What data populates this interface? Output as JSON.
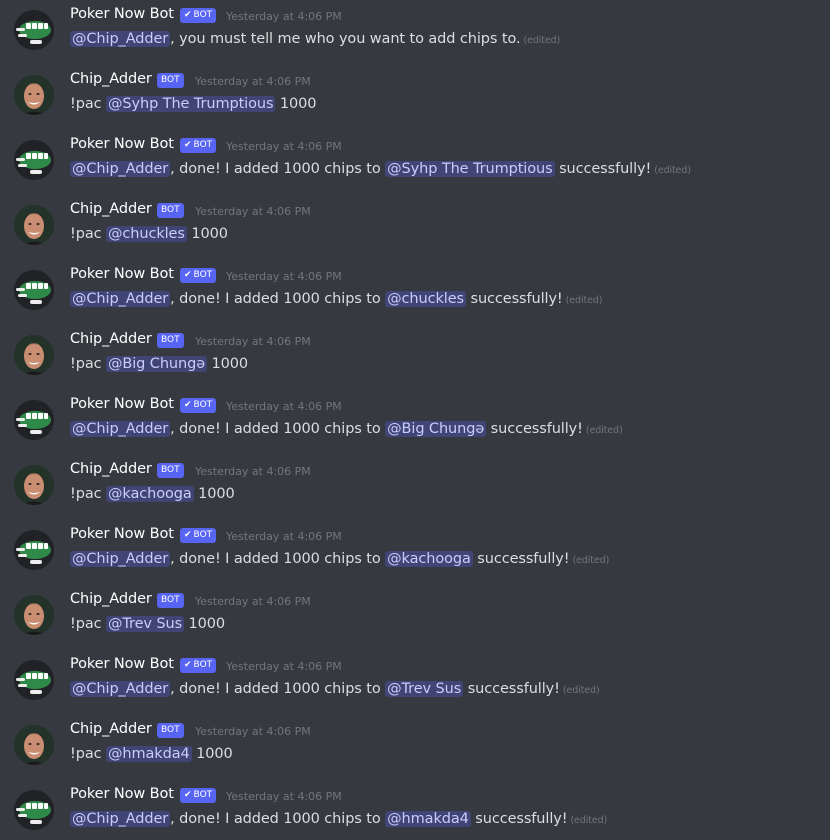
{
  "channel": {
    "messages": [
      {
        "author": "Poker Now Bot",
        "tag": "BOT",
        "verified": true,
        "timestamp": "Yesterday at 4:06 PM",
        "mention": "@Chip_Adder",
        "text": ", you must tell me who you want to add chips to.",
        "edited": "(edited)"
      },
      {
        "author": "Chip_Adder",
        "tag": "BOT",
        "verified": false,
        "timestamp": "Yesterday at 4:06 PM",
        "prefix": "!pac",
        "target": "@Syhp The Trumptious",
        "amount": "1000"
      },
      {
        "author": "Poker Now Bot",
        "tag": "BOT",
        "verified": true,
        "timestamp": "Yesterday at 4:06 PM",
        "mention": "@Chip_Adder",
        "pre": ", done! I added 1000 chips to",
        "target": "@Syhp The Trumptious",
        "post": "successfully!",
        "edited": "(edited)"
      },
      {
        "author": "Chip_Adder",
        "tag": "BOT",
        "verified": false,
        "timestamp": "Yesterday at 4:06 PM",
        "prefix": "!pac",
        "target": "@chuckles",
        "amount": "1000"
      },
      {
        "author": "Poker Now Bot",
        "tag": "BOT",
        "verified": true,
        "timestamp": "Yesterday at 4:06 PM",
        "mention": "@Chip_Adder",
        "pre": ", done! I added 1000 chips to",
        "target": "@chuckles",
        "post": "successfully!",
        "edited": "(edited)"
      },
      {
        "author": "Chip_Adder",
        "tag": "BOT",
        "verified": false,
        "timestamp": "Yesterday at 4:06 PM",
        "prefix": "!pac",
        "target": "@Big Chungə",
        "amount": "1000"
      },
      {
        "author": "Poker Now Bot",
        "tag": "BOT",
        "verified": true,
        "timestamp": "Yesterday at 4:06 PM",
        "mention": "@Chip_Adder",
        "pre": ", done! I added 1000 chips to",
        "target": "@Big Chungə",
        "post": "successfully!",
        "edited": "(edited)"
      },
      {
        "author": "Chip_Adder",
        "tag": "BOT",
        "verified": false,
        "timestamp": "Yesterday at 4:06 PM",
        "prefix": "!pac",
        "target": "@kachooga",
        "amount": "1000"
      },
      {
        "author": "Poker Now Bot",
        "tag": "BOT",
        "verified": true,
        "timestamp": "Yesterday at 4:06 PM",
        "mention": "@Chip_Adder",
        "pre": ", done! I added 1000 chips to",
        "target": "@kachooga",
        "post": "successfully!",
        "edited": "(edited)"
      },
      {
        "author": "Chip_Adder",
        "tag": "BOT",
        "verified": false,
        "timestamp": "Yesterday at 4:06 PM",
        "prefix": "!pac",
        "target": "@Trev Sus",
        "amount": "1000"
      },
      {
        "author": "Poker Now Bot",
        "tag": "BOT",
        "verified": true,
        "timestamp": "Yesterday at 4:06 PM",
        "mention": "@Chip_Adder",
        "pre": ", done! I added 1000 chips to",
        "target": "@Trev Sus",
        "post": "successfully!",
        "edited": "(edited)"
      },
      {
        "author": "Chip_Adder",
        "tag": "BOT",
        "verified": false,
        "timestamp": "Yesterday at 4:06 PM",
        "prefix": "!pac",
        "target": "@hmakda4",
        "amount": "1000"
      },
      {
        "author": "Poker Now Bot",
        "tag": "BOT",
        "verified": true,
        "timestamp": "Yesterday at 4:06 PM",
        "mention": "@Chip_Adder",
        "pre": ", done! I added 1000 chips to",
        "target": "@hmakda4",
        "post": "successfully!",
        "edited": "(edited)"
      }
    ]
  },
  "icons": {
    "poker_avatar": "poker-table-avatar-icon",
    "user_avatar": "user-photo-avatar-icon",
    "verified": "checkmark-icon"
  },
  "colors": {
    "background": "#36393f",
    "bot_tag": "#5865f2",
    "mention_bg": "#414675",
    "mention_text": "#c9cdfb",
    "timestamp": "#72767d"
  }
}
